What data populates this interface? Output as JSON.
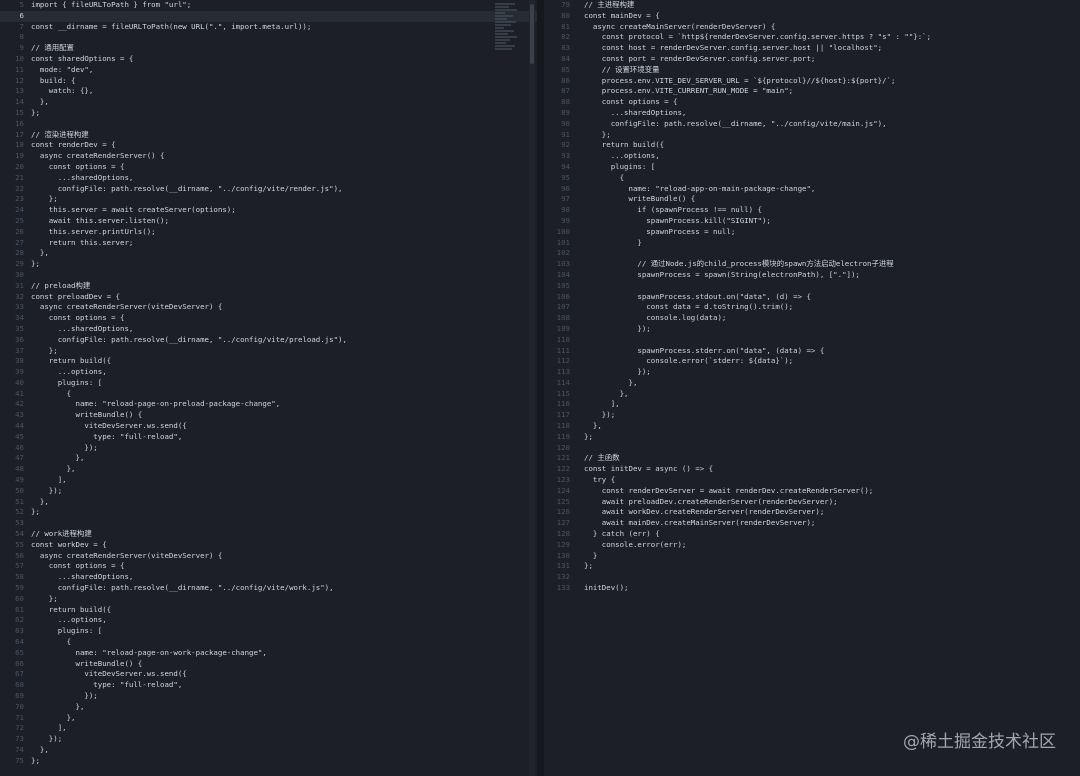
{
  "left_pane": {
    "lines": [
      {
        "n": "5",
        "t": "import { fileURLToPath } from \"url\";"
      },
      {
        "n": "6",
        "t": "",
        "current": true
      },
      {
        "n": "7",
        "t": "const __dirname = fileURLToPath(new URL(\".\", import.meta.url));"
      },
      {
        "n": "8",
        "t": ""
      },
      {
        "n": "9",
        "t": "// 通用配置"
      },
      {
        "n": "10",
        "t": "const sharedOptions = {"
      },
      {
        "n": "11",
        "t": "  mode: \"dev\","
      },
      {
        "n": "12",
        "t": "  build: {"
      },
      {
        "n": "13",
        "t": "    watch: {},"
      },
      {
        "n": "14",
        "t": "  },"
      },
      {
        "n": "15",
        "t": "};"
      },
      {
        "n": "16",
        "t": ""
      },
      {
        "n": "17",
        "t": "// 渲染进程构建"
      },
      {
        "n": "18",
        "t": "const renderDev = {"
      },
      {
        "n": "19",
        "t": "  async createRenderServer() {"
      },
      {
        "n": "20",
        "t": "    const options = {"
      },
      {
        "n": "21",
        "t": "      ...sharedOptions,"
      },
      {
        "n": "22",
        "t": "      configFile: path.resolve(__dirname, \"../config/vite/render.js\"),"
      },
      {
        "n": "23",
        "t": "    };"
      },
      {
        "n": "24",
        "t": "    this.server = await createServer(options);"
      },
      {
        "n": "25",
        "t": "    await this.server.listen();"
      },
      {
        "n": "26",
        "t": "    this.server.printUrls();"
      },
      {
        "n": "27",
        "t": "    return this.server;"
      },
      {
        "n": "28",
        "t": "  },"
      },
      {
        "n": "29",
        "t": "};"
      },
      {
        "n": "30",
        "t": ""
      },
      {
        "n": "31",
        "t": "// preload构建"
      },
      {
        "n": "32",
        "t": "const preloadDev = {"
      },
      {
        "n": "33",
        "t": "  async createRenderServer(viteDevServer) {"
      },
      {
        "n": "34",
        "t": "    const options = {"
      },
      {
        "n": "35",
        "t": "      ...sharedOptions,"
      },
      {
        "n": "36",
        "t": "      configFile: path.resolve(__dirname, \"../config/vite/preload.js\"),"
      },
      {
        "n": "37",
        "t": "    };"
      },
      {
        "n": "38",
        "t": "    return build({"
      },
      {
        "n": "39",
        "t": "      ...options,"
      },
      {
        "n": "40",
        "t": "      plugins: ["
      },
      {
        "n": "41",
        "t": "        {"
      },
      {
        "n": "42",
        "t": "          name: \"reload-page-on-preload-package-change\","
      },
      {
        "n": "43",
        "t": "          writeBundle() {"
      },
      {
        "n": "44",
        "t": "            viteDevServer.ws.send({"
      },
      {
        "n": "45",
        "t": "              type: \"full-reload\","
      },
      {
        "n": "46",
        "t": "            });"
      },
      {
        "n": "47",
        "t": "          },"
      },
      {
        "n": "48",
        "t": "        },"
      },
      {
        "n": "49",
        "t": "      ],"
      },
      {
        "n": "50",
        "t": "    });"
      },
      {
        "n": "51",
        "t": "  },"
      },
      {
        "n": "52",
        "t": "};"
      },
      {
        "n": "53",
        "t": ""
      },
      {
        "n": "54",
        "t": "// work进程构建"
      },
      {
        "n": "55",
        "t": "const workDev = {"
      },
      {
        "n": "56",
        "t": "  async createRenderServer(viteDevServer) {"
      },
      {
        "n": "57",
        "t": "    const options = {"
      },
      {
        "n": "58",
        "t": "      ...sharedOptions,"
      },
      {
        "n": "59",
        "t": "      configFile: path.resolve(__dirname, \"../config/vite/work.js\"),"
      },
      {
        "n": "60",
        "t": "    };"
      },
      {
        "n": "61",
        "t": "    return build({"
      },
      {
        "n": "62",
        "t": "      ...options,"
      },
      {
        "n": "63",
        "t": "      plugins: ["
      },
      {
        "n": "64",
        "t": "        {"
      },
      {
        "n": "65",
        "t": "          name: \"reload-page-on-work-package-change\","
      },
      {
        "n": "66",
        "t": "          writeBundle() {"
      },
      {
        "n": "67",
        "t": "            viteDevServer.ws.send({"
      },
      {
        "n": "68",
        "t": "              type: \"full-reload\","
      },
      {
        "n": "69",
        "t": "            });"
      },
      {
        "n": "70",
        "t": "          },"
      },
      {
        "n": "71",
        "t": "        },"
      },
      {
        "n": "72",
        "t": "      ],"
      },
      {
        "n": "73",
        "t": "    });"
      },
      {
        "n": "74",
        "t": "  },"
      },
      {
        "n": "75",
        "t": "};"
      }
    ]
  },
  "right_pane": {
    "lines": [
      {
        "n": "79",
        "t": "// 主进程构建"
      },
      {
        "n": "80",
        "t": "const mainDev = {"
      },
      {
        "n": "81",
        "t": "  async createMainServer(renderDevServer) {"
      },
      {
        "n": "82",
        "t": "    const protocol = `http${renderDevServer.config.server.https ? \"s\" : \"\"}:`;"
      },
      {
        "n": "83",
        "t": "    const host = renderDevServer.config.server.host || \"localhost\";"
      },
      {
        "n": "84",
        "t": "    const port = renderDevServer.config.server.port;"
      },
      {
        "n": "85",
        "t": "    // 设置环境变量"
      },
      {
        "n": "86",
        "t": "    process.env.VITE_DEV_SERVER_URL = `${protocol}//${host}:${port}/`;"
      },
      {
        "n": "87",
        "t": "    process.env.VITE_CURRENT_RUN_MODE = \"main\";"
      },
      {
        "n": "88",
        "t": "    const options = {"
      },
      {
        "n": "89",
        "t": "      ...sharedOptions,"
      },
      {
        "n": "90",
        "t": "      configFile: path.resolve(__dirname, \"../config/vite/main.js\"),"
      },
      {
        "n": "91",
        "t": "    };"
      },
      {
        "n": "92",
        "t": "    return build({"
      },
      {
        "n": "93",
        "t": "      ...options,"
      },
      {
        "n": "94",
        "t": "      plugins: ["
      },
      {
        "n": "95",
        "t": "        {"
      },
      {
        "n": "96",
        "t": "          name: \"reload-app-on-main-package-change\","
      },
      {
        "n": "97",
        "t": "          writeBundle() {"
      },
      {
        "n": "98",
        "t": "            if (spawnProcess !== null) {"
      },
      {
        "n": "99",
        "t": "              spawnProcess.kill(\"SIGINT\");"
      },
      {
        "n": "100",
        "t": "              spawnProcess = null;"
      },
      {
        "n": "101",
        "t": "            }"
      },
      {
        "n": "102",
        "t": ""
      },
      {
        "n": "103",
        "t": "            // 通过Node.js的child_process模块的spawn方法启动electron子进程"
      },
      {
        "n": "104",
        "t": "            spawnProcess = spawn(String(electronPath), [\".\"]);"
      },
      {
        "n": "105",
        "t": ""
      },
      {
        "n": "106",
        "t": "            spawnProcess.stdout.on(\"data\", (d) => {"
      },
      {
        "n": "107",
        "t": "              const data = d.toString().trim();"
      },
      {
        "n": "108",
        "t": "              console.log(data);"
      },
      {
        "n": "109",
        "t": "            });"
      },
      {
        "n": "110",
        "t": ""
      },
      {
        "n": "111",
        "t": "            spawnProcess.stderr.on(\"data\", (data) => {"
      },
      {
        "n": "112",
        "t": "              console.error(`stderr: ${data}`);"
      },
      {
        "n": "113",
        "t": "            });"
      },
      {
        "n": "114",
        "t": "          },"
      },
      {
        "n": "115",
        "t": "        },"
      },
      {
        "n": "116",
        "t": "      ],"
      },
      {
        "n": "117",
        "t": "    });"
      },
      {
        "n": "118",
        "t": "  },"
      },
      {
        "n": "119",
        "t": "};"
      },
      {
        "n": "120",
        "t": ""
      },
      {
        "n": "121",
        "t": "// 主函数"
      },
      {
        "n": "122",
        "t": "const initDev = async () => {"
      },
      {
        "n": "123",
        "t": "  try {"
      },
      {
        "n": "124",
        "t": "    const renderDevServer = await renderDev.createRenderServer();"
      },
      {
        "n": "125",
        "t": "    await preloadDev.createRenderServer(renderDevServer);"
      },
      {
        "n": "126",
        "t": "    await workDev.createRenderServer(renderDevServer);"
      },
      {
        "n": "127",
        "t": "    await mainDev.createMainServer(renderDevServer);"
      },
      {
        "n": "128",
        "t": "  } catch (err) {"
      },
      {
        "n": "129",
        "t": "    console.error(err);"
      },
      {
        "n": "130",
        "t": "  }"
      },
      {
        "n": "131",
        "t": "};"
      },
      {
        "n": "132",
        "t": ""
      },
      {
        "n": "133",
        "t": "initDev();"
      }
    ]
  },
  "watermark": "@稀土掘金技术社区"
}
